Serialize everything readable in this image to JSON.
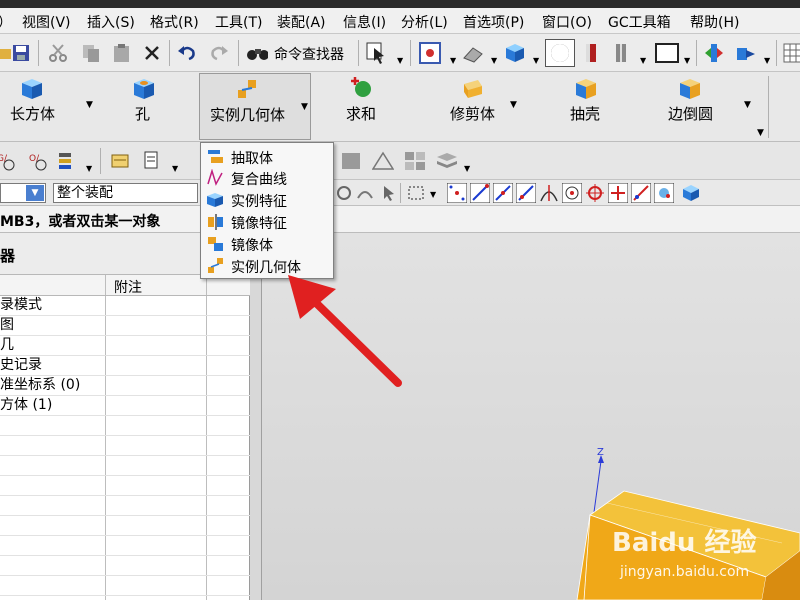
{
  "menubar": {
    "items": [
      "视图(V)",
      "插入(S)",
      "格式(R)",
      "工具(T)",
      "装配(A)",
      "信息(I)",
      "分析(L)",
      "首选项(P)",
      "窗口(O)",
      "GC工具箱",
      "帮助(H)"
    ]
  },
  "toolbar": {
    "command_finder": "命令查找器"
  },
  "ribbon": {
    "block": "长方体",
    "hole": "孔",
    "pattern_geometry": "实例几何体",
    "unite": "求和",
    "trim_body": "修剪体",
    "shell": "抽壳",
    "edge_blend": "边倒圆"
  },
  "selection_bar": {
    "scope": "整个装配"
  },
  "cue_line": {
    "text": "MB3，或者双击某一对象"
  },
  "navigator": {
    "title": "器",
    "columns": {
      "note": "附注"
    },
    "rows": [
      "录模式",
      "图",
      "几",
      "史记录",
      "准坐标系 (0)",
      "方体 (1)"
    ]
  },
  "dropdown": {
    "items": [
      "抽取体",
      "复合曲线",
      "实例特征",
      "镜像特征",
      "镜像体",
      "实例几何体"
    ]
  },
  "viewport": {
    "axis_z": "Z"
  },
  "watermark": {
    "logo": "Baidu 经验",
    "url": "jingyan.baidu.com"
  },
  "colors": {
    "arrow": "#e02020",
    "block_top": "#f3c23a",
    "block_front": "#f0a818",
    "block_side": "#d98c10",
    "axis": "#2b3bd8"
  }
}
